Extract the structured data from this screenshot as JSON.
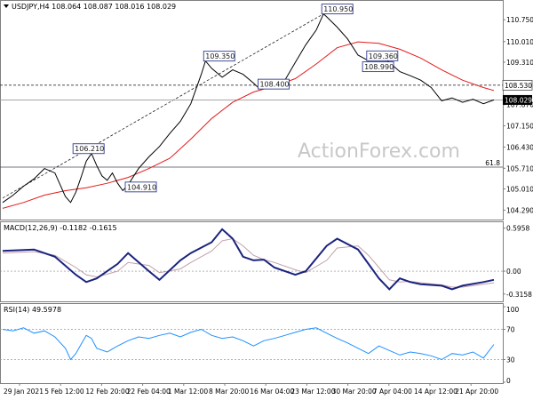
{
  "chart_data": {
    "type": "line",
    "watermark": "ActionForex.com",
    "x_tick_labels": [
      "29 Jan 2021",
      "5 Feb 12:00",
      "12 Feb 20:00",
      "22 Feb 04:00",
      "1 Mar 12:00",
      "8 Mar 20:00",
      "16 Mar 04:00",
      "23 Mar 12:00",
      "30 Mar 20:00",
      "7 Apr 04:00",
      "14 Apr 12:00",
      "21 Apr 20:00"
    ],
    "price": {
      "title": "USDJPY,H4  108.064 108.087 108.016 108.029",
      "ylim": [
        104.0,
        111.3
      ],
      "y_ticks": [
        "110.750",
        "110.010",
        "109.310",
        "108.530",
        "108.029",
        "107.870",
        "107.150",
        "106.430",
        "105.710",
        "105.010",
        "104.290"
      ],
      "current_price": "108.029",
      "current_price_value": 108.029,
      "hline_value": 108.53,
      "hline_label": "108.530",
      "fib_value": 105.75,
      "fib_label": "61.8",
      "labels": [
        {
          "text": "110.950",
          "x": 30.7,
          "y": 110.95
        },
        {
          "text": "109.350",
          "x": 19.4,
          "y": 109.35
        },
        {
          "text": "106.210",
          "x": 6.9,
          "y": 106.21
        },
        {
          "text": "108.400",
          "x": 24.6,
          "y": 108.4
        },
        {
          "text": "109.360",
          "x": 35.0,
          "y": 109.36
        },
        {
          "text": "104.910",
          "x": 11.9,
          "y": 104.91
        },
        {
          "text": "108.990",
          "x": 34.6,
          "y": 108.99
        }
      ],
      "close": [
        [
          0,
          104.55
        ],
        [
          1,
          104.8
        ],
        [
          2,
          105.1
        ],
        [
          3,
          105.35
        ],
        [
          4,
          105.7
        ],
        [
          5,
          105.55
        ],
        [
          6,
          104.75
        ],
        [
          6.5,
          104.55
        ],
        [
          7,
          104.9
        ],
        [
          7.5,
          105.4
        ],
        [
          8,
          105.95
        ],
        [
          8.5,
          106.21
        ],
        [
          9,
          105.8
        ],
        [
          9.5,
          105.45
        ],
        [
          10,
          105.3
        ],
        [
          10.5,
          105.55
        ],
        [
          11,
          105.2
        ],
        [
          11.5,
          104.95
        ],
        [
          12,
          105.15
        ],
        [
          13,
          105.7
        ],
        [
          14,
          106.1
        ],
        [
          15,
          106.45
        ],
        [
          16,
          106.9
        ],
        [
          17,
          107.3
        ],
        [
          18,
          107.9
        ],
        [
          18.5,
          108.4
        ],
        [
          19,
          108.9
        ],
        [
          19.4,
          109.35
        ],
        [
          20,
          109.1
        ],
        [
          21,
          108.8
        ],
        [
          22,
          109.05
        ],
        [
          23,
          108.9
        ],
        [
          24,
          108.6
        ],
        [
          24.6,
          108.4
        ],
        [
          25,
          108.65
        ],
        [
          26,
          108.6
        ],
        [
          27,
          108.7
        ],
        [
          28,
          109.3
        ],
        [
          29,
          109.9
        ],
        [
          30,
          110.4
        ],
        [
          30.7,
          110.95
        ],
        [
          31,
          110.85
        ],
        [
          32,
          110.5
        ],
        [
          33,
          110.1
        ],
        [
          34,
          109.55
        ],
        [
          35,
          109.36
        ],
        [
          36,
          109.6
        ],
        [
          37,
          109.3
        ],
        [
          38,
          108.99
        ],
        [
          39,
          108.85
        ],
        [
          40,
          108.7
        ],
        [
          41,
          108.45
        ],
        [
          42,
          108.0
        ],
        [
          43,
          108.1
        ],
        [
          44,
          107.95
        ],
        [
          45,
          108.05
        ],
        [
          46,
          107.9
        ],
        [
          47,
          108.03
        ]
      ],
      "ma": [
        [
          0,
          104.35
        ],
        [
          2,
          104.55
        ],
        [
          4,
          104.8
        ],
        [
          6,
          104.95
        ],
        [
          8,
          105.05
        ],
        [
          10,
          105.2
        ],
        [
          12,
          105.4
        ],
        [
          14,
          105.7
        ],
        [
          16,
          106.05
        ],
        [
          18,
          106.7
        ],
        [
          20,
          107.4
        ],
        [
          22,
          107.95
        ],
        [
          24,
          108.3
        ],
        [
          26,
          108.5
        ],
        [
          28,
          108.75
        ],
        [
          30,
          109.25
        ],
        [
          32,
          109.8
        ],
        [
          34,
          110.0
        ],
        [
          36,
          109.95
        ],
        [
          38,
          109.75
        ],
        [
          40,
          109.45
        ],
        [
          42,
          109.05
        ],
        [
          44,
          108.7
        ],
        [
          46,
          108.45
        ],
        [
          47,
          108.35
        ]
      ]
    },
    "macd": {
      "title": "MACD(12,26,9) -0.1182 -0.1615",
      "ylim": [
        -0.38,
        0.64
      ],
      "ticks": [
        {
          "v": 0.5958,
          "t": "0.5958"
        },
        {
          "v": 0.0,
          "t": "0.00"
        },
        {
          "v": -0.3158,
          "t": "-0.3158"
        }
      ],
      "line": [
        [
          0,
          0.28
        ],
        [
          3,
          0.3
        ],
        [
          5,
          0.2
        ],
        [
          7,
          -0.05
        ],
        [
          8,
          -0.15
        ],
        [
          9,
          -0.1
        ],
        [
          11,
          0.1
        ],
        [
          12,
          0.25
        ],
        [
          14,
          0.0
        ],
        [
          15,
          -0.12
        ],
        [
          17,
          0.15
        ],
        [
          18,
          0.25
        ],
        [
          20,
          0.4
        ],
        [
          21,
          0.58
        ],
        [
          22,
          0.45
        ],
        [
          23,
          0.2
        ],
        [
          24,
          0.15
        ],
        [
          25,
          0.16
        ],
        [
          26,
          0.05
        ],
        [
          28,
          -0.05
        ],
        [
          29,
          0.0
        ],
        [
          31,
          0.35
        ],
        [
          32,
          0.45
        ],
        [
          34,
          0.3
        ],
        [
          35,
          0.1
        ],
        [
          36,
          -0.1
        ],
        [
          37,
          -0.25
        ],
        [
          38,
          -0.1
        ],
        [
          39,
          -0.15
        ],
        [
          40,
          -0.18
        ],
        [
          42,
          -0.2
        ],
        [
          43,
          -0.25
        ],
        [
          44,
          -0.2
        ],
        [
          46,
          -0.15
        ],
        [
          47,
          -0.12
        ]
      ],
      "signal": [
        [
          0,
          0.25
        ],
        [
          3,
          0.27
        ],
        [
          5,
          0.22
        ],
        [
          7,
          0.05
        ],
        [
          8,
          -0.05
        ],
        [
          9,
          -0.08
        ],
        [
          11,
          0.0
        ],
        [
          12,
          0.12
        ],
        [
          14,
          0.08
        ],
        [
          15,
          -0.02
        ],
        [
          17,
          0.03
        ],
        [
          18,
          0.12
        ],
        [
          20,
          0.28
        ],
        [
          21,
          0.42
        ],
        [
          22,
          0.45
        ],
        [
          23,
          0.35
        ],
        [
          24,
          0.22
        ],
        [
          25,
          0.16
        ],
        [
          26,
          0.12
        ],
        [
          28,
          0.02
        ],
        [
          29,
          -0.02
        ],
        [
          31,
          0.15
        ],
        [
          32,
          0.32
        ],
        [
          34,
          0.35
        ],
        [
          35,
          0.22
        ],
        [
          36,
          0.05
        ],
        [
          37,
          -0.12
        ],
        [
          38,
          -0.15
        ],
        [
          39,
          -0.14
        ],
        [
          40,
          -0.16
        ],
        [
          42,
          -0.19
        ],
        [
          43,
          -0.22
        ],
        [
          44,
          -0.22
        ],
        [
          46,
          -0.18
        ],
        [
          47,
          -0.16
        ]
      ]
    },
    "rsi": {
      "title": "RSI(14) 49.5978",
      "ylim": [
        0,
        100
      ],
      "ticks": [
        {
          "v": 100,
          "t": "100"
        },
        {
          "v": 70,
          "t": "70"
        },
        {
          "v": 30,
          "t": "30"
        },
        {
          "v": 0,
          "t": "0"
        }
      ],
      "levels": [
        70,
        30
      ],
      "line": [
        [
          0,
          70
        ],
        [
          1,
          68
        ],
        [
          2,
          72
        ],
        [
          3,
          65
        ],
        [
          4,
          68
        ],
        [
          5,
          60
        ],
        [
          6,
          45
        ],
        [
          6.5,
          30
        ],
        [
          7,
          38
        ],
        [
          7.5,
          50
        ],
        [
          8,
          62
        ],
        [
          8.5,
          58
        ],
        [
          9,
          45
        ],
        [
          10,
          40
        ],
        [
          11,
          48
        ],
        [
          12,
          55
        ],
        [
          13,
          60
        ],
        [
          14,
          58
        ],
        [
          15,
          62
        ],
        [
          16,
          65
        ],
        [
          17,
          60
        ],
        [
          18,
          66
        ],
        [
          19,
          70
        ],
        [
          20,
          62
        ],
        [
          21,
          58
        ],
        [
          22,
          60
        ],
        [
          23,
          55
        ],
        [
          24,
          48
        ],
        [
          25,
          55
        ],
        [
          26,
          58
        ],
        [
          27,
          62
        ],
        [
          28,
          66
        ],
        [
          29,
          70
        ],
        [
          30,
          72
        ],
        [
          31,
          65
        ],
        [
          32,
          58
        ],
        [
          33,
          52
        ],
        [
          34,
          45
        ],
        [
          35,
          38
        ],
        [
          36,
          48
        ],
        [
          37,
          42
        ],
        [
          38,
          36
        ],
        [
          39,
          40
        ],
        [
          40,
          38
        ],
        [
          41,
          35
        ],
        [
          42,
          30
        ],
        [
          43,
          38
        ],
        [
          44,
          36
        ],
        [
          45,
          40
        ],
        [
          46,
          32
        ],
        [
          47,
          50
        ]
      ]
    }
  }
}
